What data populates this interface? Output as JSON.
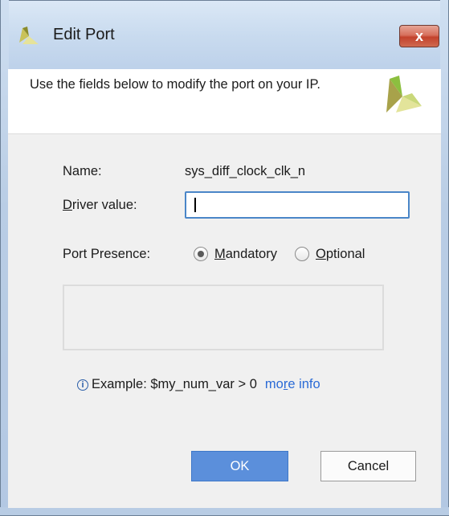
{
  "window": {
    "title": "Edit Port",
    "close_label": "x"
  },
  "header": {
    "description": "Use the fields below to modify the port on your IP.",
    "logo_icon": "xilinx-logo"
  },
  "form": {
    "name_label": "Name:",
    "name_value": "sys_diff_clock_clk_n",
    "driver_label_mnemonic": "D",
    "driver_label_rest": "river value:",
    "driver_value": "",
    "presence_label": "Port Presence:",
    "presence_options": [
      {
        "mnemonic": "M",
        "rest": "andatory",
        "selected": true
      },
      {
        "mnemonic": "O",
        "rest": "ptional",
        "selected": false
      }
    ]
  },
  "example": {
    "icon": "info-icon",
    "text": "Example:  $my_num_var > 0",
    "link_before": "mo",
    "link_mnemonic": "r",
    "link_after": "e info"
  },
  "buttons": {
    "ok_label": "OK",
    "cancel_label": "Cancel"
  },
  "colors": {
    "accent": "#5b8fdb",
    "link": "#2b6bd6",
    "focus_border": "#4a86c8",
    "close_button": "#c3422c",
    "logo_green": "#8cbf3f",
    "logo_olive": "#a9a04a"
  }
}
